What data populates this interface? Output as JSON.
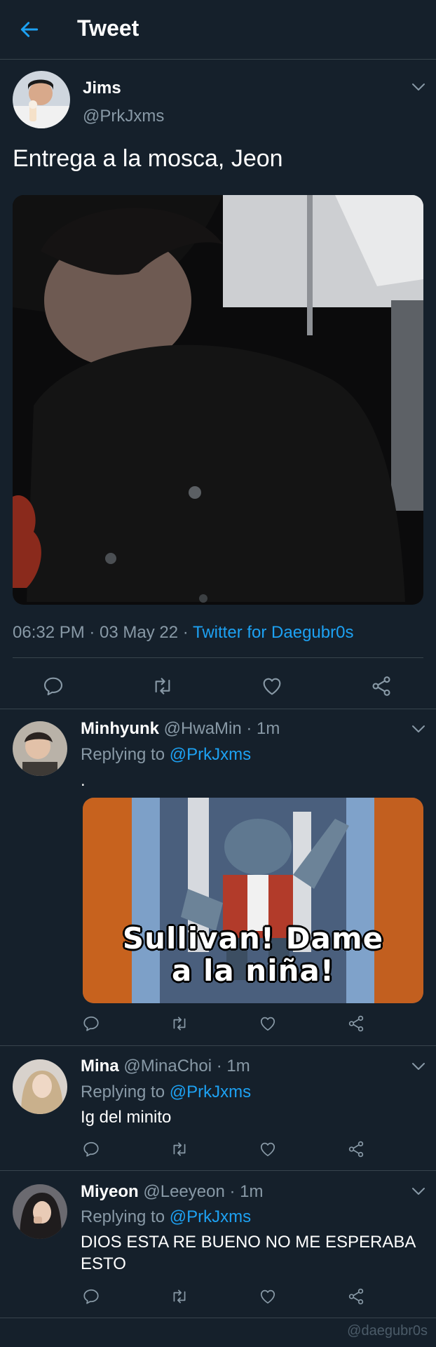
{
  "header": {
    "title": "Tweet",
    "back_icon": "back-arrow-icon"
  },
  "colors": {
    "background": "#15202b",
    "accent": "#1da1f2",
    "muted": "#8899a6",
    "divider": "#38444d"
  },
  "tweet": {
    "name": "Jims",
    "handle": "@PrkJxms",
    "text": "Entrega a la mosca, Jeon",
    "time": "06:32 PM · 03 May 22 · ",
    "source": "Twitter for Daegubr0s"
  },
  "replies": [
    {
      "name": "Minhyunk",
      "handle_time": " @HwaMin · 1m",
      "replying_label": "Replying to ",
      "replying_handle": "@PrkJxms",
      "text": ".",
      "meme_line1": "Sullivan! Dame",
      "meme_line2": "a la niña!"
    },
    {
      "name": "Mina",
      "handle_time": " @MinaChoi · 1m",
      "replying_label": "Replying to ",
      "replying_handle": "@PrkJxms",
      "text": "Ig del minito"
    },
    {
      "name": "Miyeon",
      "handle_time": " @Leeyeon · 1m",
      "replying_label": "Replying to ",
      "replying_handle": "@PrkJxms",
      "text": "DIOS ESTA RE BUENO NO ME ESPERABA ESTO"
    }
  ],
  "watermark": "@daegubr0s"
}
